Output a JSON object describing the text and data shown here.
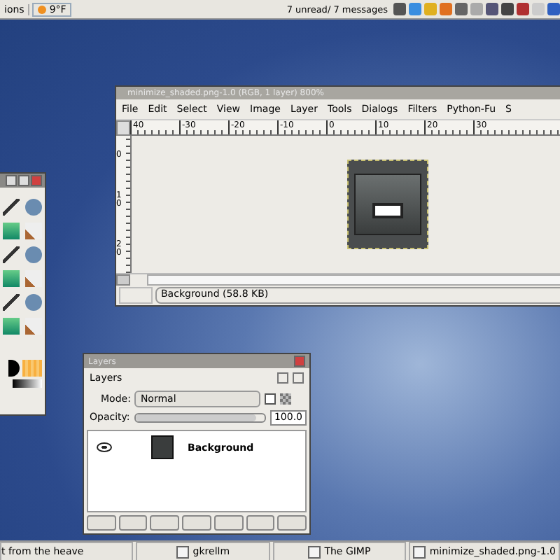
{
  "top_panel": {
    "menu_label": "ions",
    "weather": "9°F",
    "mail_status": "7 unread/ 7 messages"
  },
  "image_window": {
    "title": "minimize_shaded.png-1.0 (RGB, 1 layer) 800%",
    "menu": [
      "File",
      "Edit",
      "Select",
      "View",
      "Image",
      "Layer",
      "Tools",
      "Dialogs",
      "Filters",
      "Python-Fu",
      "S"
    ],
    "ruler_labels": [
      "40",
      "-30",
      "-20",
      "-10",
      "0",
      "10",
      "20",
      "30"
    ],
    "vertical_ruler_labels": [
      "0",
      "10",
      "20"
    ],
    "status": "Background (58.8 KB)"
  },
  "layers_dialog": {
    "title": "Layers",
    "heading": "Layers",
    "mode_label": "Mode:",
    "mode_value": "Normal",
    "lock_checked": false,
    "opacity_label": "Opacity:",
    "opacity": {
      "level": 0.93,
      "value": "100.0"
    },
    "layers": [
      {
        "name": "Background",
        "visible": true
      }
    ]
  },
  "taskbar": [
    {
      "label": "t from the heave"
    },
    {
      "label": "gkrellm"
    },
    {
      "label": "The GIMP"
    },
    {
      "label": "minimize_shaded.png-1.0"
    }
  ]
}
